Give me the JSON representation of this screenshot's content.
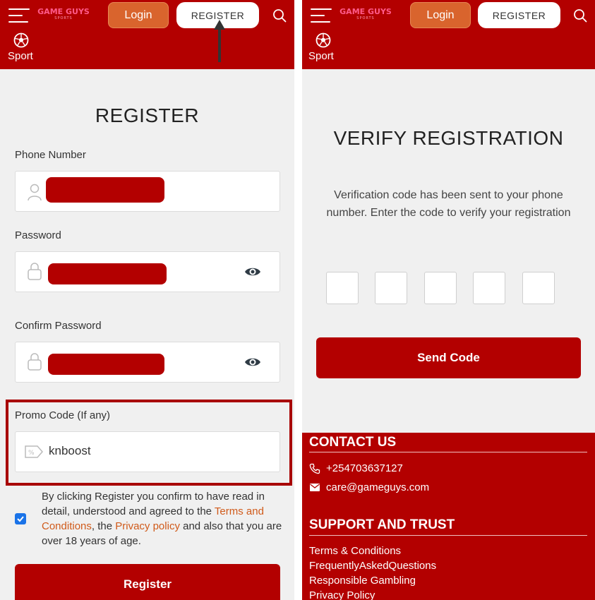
{
  "header": {
    "logo_main": "GAME GUYS",
    "logo_sub": "SPORTS",
    "login_label": "Login",
    "register_label": "REGISTER",
    "sport_label": "Sport"
  },
  "register_form": {
    "title": "REGISTER",
    "phone_label": "Phone Number",
    "password_label": "Password",
    "confirm_label": "Confirm Password",
    "promo_label": "Promo Code (If any)",
    "promo_value": "knboost",
    "terms_prefix": "By clicking Register you confirm to have read in detail, understood and agreed to the ",
    "terms_link": "Terms and Conditions",
    "terms_mid": ", the ",
    "privacy_link": "Privacy policy",
    "terms_suffix": " and also that you are over 18 years of age.",
    "terms_checked": true,
    "submit_label": "Register"
  },
  "verify": {
    "title": "VERIFY REGISTRATION",
    "message": "Verification code has been sent to your phone number. Enter the code to verify your registration",
    "code_digits": 5,
    "send_label": "Send Code"
  },
  "footer": {
    "contact_heading": "CONTACT US",
    "phone": "+254703637127",
    "email": "care@gameguys.com",
    "support_heading": "SUPPORT AND TRUST",
    "links": [
      "Terms & Conditions",
      "FrequentlyAskedQuestions",
      "Responsible Gambling",
      "Privacy Policy"
    ]
  },
  "colors": {
    "brand_red": "#b30000",
    "login_orange": "#d9642d",
    "link_orange": "#d05a1a",
    "checkbox_blue": "#1a73e8"
  },
  "icons": [
    "hamburger-icon",
    "search-icon",
    "soccer-ball-icon",
    "user-icon",
    "lock-icon",
    "eye-icon",
    "tag-icon",
    "phone-icon",
    "mail-icon",
    "arrow-up-icon"
  ]
}
